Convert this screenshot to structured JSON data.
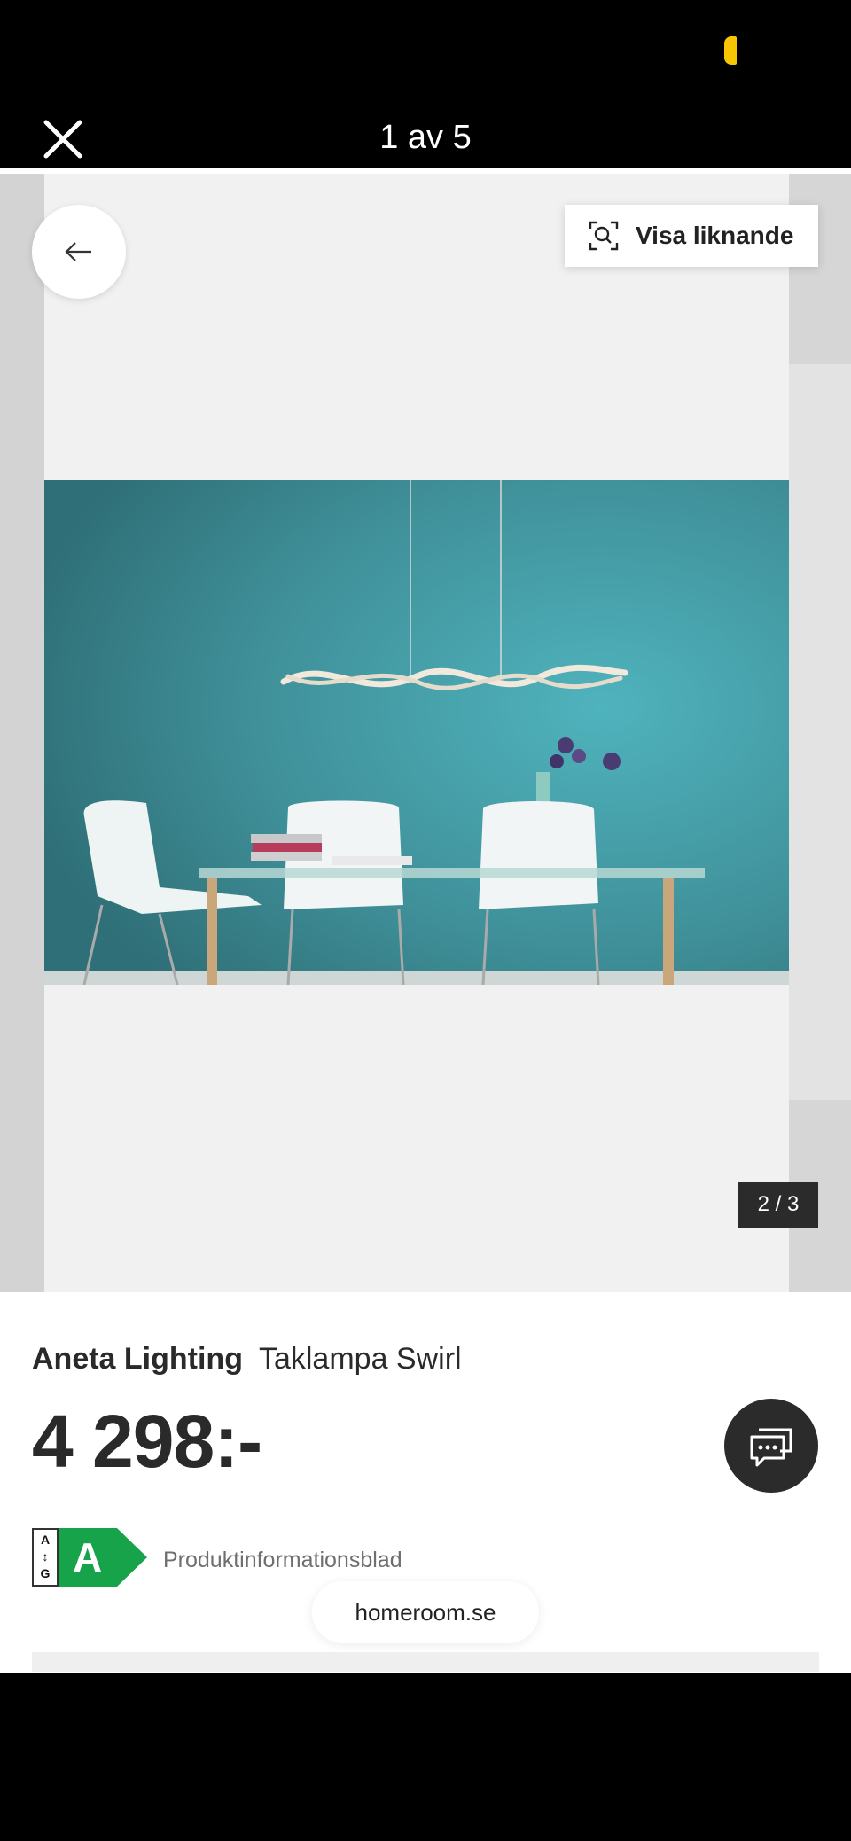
{
  "header": {
    "close_icon": "close-icon",
    "counter_label": "1 av 5"
  },
  "status_bar": {
    "battery_color": "#f7c600"
  },
  "gallery": {
    "back_icon": "arrow-left-icon",
    "similar_label": "Visa liknande",
    "similar_icon": "visual-search-icon",
    "image_counter": "2 / 3",
    "photo_description_icon": "product-photo"
  },
  "product": {
    "brand": "Aneta Lighting",
    "name": "Taklampa Swirl",
    "price": "4 298:-",
    "energy_scale_top": "A",
    "energy_scale_bottom": "G",
    "energy_rating": "A",
    "energy_color": "#17a34a",
    "info_sheet_label": "Produktinformationsblad",
    "chat_icon": "chat-bubble-icon"
  },
  "browser": {
    "domain": "homeroom.se"
  }
}
